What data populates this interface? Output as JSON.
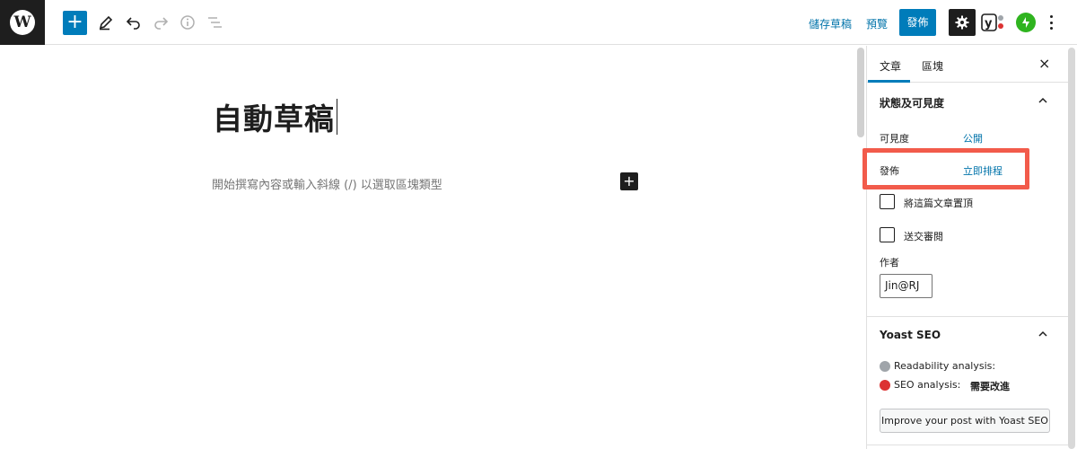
{
  "toolbar": {
    "save_draft_label": "儲存草稿",
    "preview_label": "預覽",
    "publish_label": "發佈",
    "add_block_symbol": "+"
  },
  "editor": {
    "post_title": "自動草稿",
    "block_placeholder": "開始撰寫內容或輸入斜線 (/) 以選取區塊類型",
    "block_add_symbol": "+"
  },
  "sidebar": {
    "tabs": [
      {
        "label": "文章",
        "active": true
      },
      {
        "label": "區塊",
        "active": false
      }
    ],
    "close_symbol": "×",
    "status_panel": {
      "title": "狀態及可見度",
      "visibility_label": "可見度",
      "visibility_value": "公開",
      "publish_label": "發佈",
      "publish_value": "立即排程",
      "sticky_label": "將這篇文章置頂",
      "review_label": "送交審閱",
      "author_label": "作者",
      "author_value": "Jin@RJ"
    },
    "yoast_panel": {
      "title": "Yoast SEO",
      "readability_label": "Readability analysis:",
      "seo_label": "SEO analysis:",
      "seo_value": "需要改進",
      "improve_button": "Improve your post with Yoast SEO"
    }
  },
  "colors": {
    "accent": "#007cba",
    "link": "#0073aa",
    "highlight": "#f25b4b",
    "jetpack": "#2fb41f",
    "readability_dot": "#a0a5aa",
    "seo_dot": "#dc3232"
  },
  "icons": [
    "wordpress-logo",
    "plus-icon",
    "pencil-icon",
    "undo-icon",
    "redo-icon",
    "info-icon",
    "list-view-icon",
    "gear-icon",
    "yoast-icon",
    "jetpack-icon",
    "more-vertical-icon",
    "close-icon",
    "chevron-up-icon"
  ]
}
